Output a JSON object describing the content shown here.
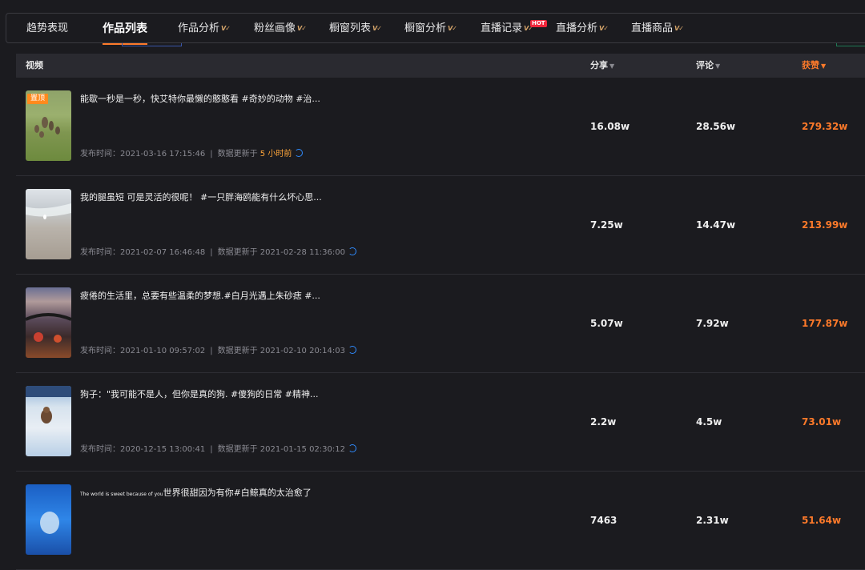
{
  "tabs": [
    {
      "label": "趋势表现",
      "vip": false,
      "hot": false,
      "active": false
    },
    {
      "label": "作品列表",
      "vip": false,
      "hot": false,
      "active": true
    },
    {
      "label": "作品分析",
      "vip": true,
      "hot": false,
      "active": false
    },
    {
      "label": "粉丝画像",
      "vip": true,
      "hot": false,
      "active": false
    },
    {
      "label": "橱窗列表",
      "vip": true,
      "hot": false,
      "active": false
    },
    {
      "label": "橱窗分析",
      "vip": true,
      "hot": false,
      "active": false
    },
    {
      "label": "直播记录",
      "vip": true,
      "hot": true,
      "active": false
    },
    {
      "label": "直播分析",
      "vip": true,
      "hot": false,
      "active": false
    },
    {
      "label": "直播商品",
      "vip": true,
      "hot": false,
      "active": false
    }
  ],
  "badges": {
    "vip": "V✓",
    "hot": "HOT",
    "pin": "置顶"
  },
  "columns": {
    "video": "视频",
    "shares": {
      "label": "分享",
      "arrow": "▼"
    },
    "comments": {
      "label": "评论",
      "arrow": "▼"
    },
    "likes": {
      "label": "获赞",
      "arrow": "▼"
    }
  },
  "labels": {
    "publish": "发布时间：",
    "updated": "数据更新于",
    "separator": "|"
  },
  "rows": [
    {
      "pinned": true,
      "title": "能歇一秒是一秒，快艾特你最懒的憨憨看 #奇妙的动物 #治...",
      "publish_time": "2021-03-16 17:15:46",
      "updated": "5 小时前",
      "updated_recent": true,
      "shares": "16.08w",
      "comments": "28.56w",
      "likes": "279.32w"
    },
    {
      "pinned": false,
      "title": "我的腿虽短 可是灵活的很呢！ #一只胖海鸥能有什么坏心思...",
      "publish_time": "2021-02-07 16:46:48",
      "updated": "2021-02-28 11:36:00",
      "updated_recent": false,
      "shares": "7.25w",
      "comments": "14.47w",
      "likes": "213.99w"
    },
    {
      "pinned": false,
      "title": "疲倦的生活里，总要有些温柔的梦想.#白月光遇上朱砂痣 #...",
      "publish_time": "2021-01-10 09:57:02",
      "updated": "2021-02-10 20:14:03",
      "updated_recent": false,
      "shares": "5.07w",
      "comments": "7.92w",
      "likes": "177.87w"
    },
    {
      "pinned": false,
      "title": "狗子：\"我可能不是人，但你是真的狗. #傻狗的日常 #精神...",
      "publish_time": "2020-12-15 13:00:41",
      "updated": "2021-01-15 02:30:12",
      "updated_recent": false,
      "shares": "2.2w",
      "comments": "4.5w",
      "likes": "73.01w"
    },
    {
      "pinned": false,
      "title_prefix": "The world is sweet because of you",
      "title": "世界很甜因为有你#白鲸真的太治愈了",
      "publish_time": "",
      "updated": "",
      "updated_recent": false,
      "shares": "7463",
      "comments": "2.31w",
      "likes": "51.64w"
    }
  ],
  "colors": {
    "accent": "#fe7a2a",
    "background": "#1b1b1f",
    "header": "#2a2a30",
    "hot": "#f0263b",
    "refresh": "#2f8cff"
  }
}
